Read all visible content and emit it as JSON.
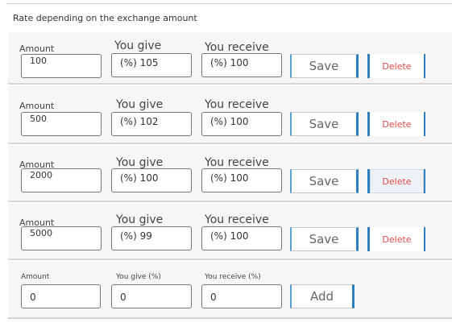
{
  "section_title": "Rate depending on the exchange amount",
  "labels": {
    "amount": "Amount",
    "you_give": "You give",
    "you_receive": "You receive",
    "you_give_pct": "You give (%)",
    "you_receive_pct": "You receive (%)"
  },
  "buttons": {
    "save": "Save",
    "delete": "Delete",
    "add": "Add"
  },
  "rates": [
    {
      "amount": "100",
      "give": "(%) 105",
      "receive": "(%) 100"
    },
    {
      "amount": "500",
      "give": "(%) 102",
      "receive": "(%) 100"
    },
    {
      "amount": "2000",
      "give": "(%) 100",
      "receive": "(%) 100"
    },
    {
      "amount": "5000",
      "give": "(%) 99",
      "receive": "(%) 100"
    }
  ],
  "new_rate": {
    "amount": "0",
    "give": "0",
    "receive": "0"
  },
  "colors": {
    "accent": "#2f7fc0",
    "delete_text": "#e34a4a",
    "row_background": "#f6f6f6"
  }
}
